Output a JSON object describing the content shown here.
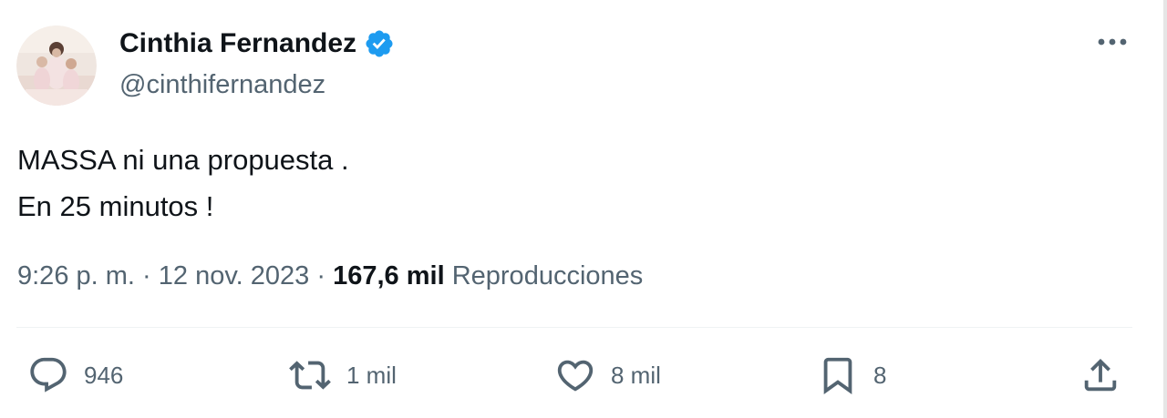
{
  "author": {
    "name": "Cinthia Fernandez",
    "handle": "@cinthifernandez",
    "verified": true,
    "verified_color": "#1d9bf0"
  },
  "icons": {
    "more": "more-horizontal-icon",
    "reply": "reply-icon",
    "retweet": "retweet-icon",
    "like": "heart-icon",
    "bookmark": "bookmark-icon",
    "share": "share-icon"
  },
  "tweet": {
    "lines": [
      "MASSA ni una propuesta .",
      "En 25 minutos !"
    ]
  },
  "meta": {
    "time": "9:26 p. m.",
    "separator": "·",
    "date": "12 nov. 2023",
    "views_count": "167,6 mil",
    "views_label": "Reproducciones"
  },
  "actions": {
    "replies": "946",
    "reposts": "1 mil",
    "likes": "8 mil",
    "bookmarks": "8"
  },
  "colors": {
    "text_primary": "#0f1419",
    "text_secondary": "#536471",
    "divider": "#eff3f4"
  }
}
